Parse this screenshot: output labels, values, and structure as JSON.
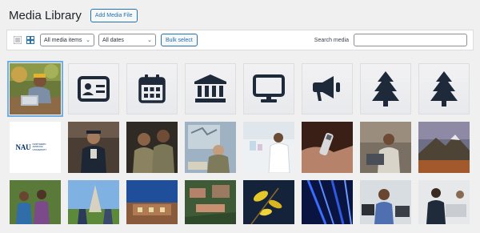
{
  "header": {
    "title": "Media Library",
    "add_button": "Add Media File"
  },
  "toolbar": {
    "list_view_icon": "list-view-icon",
    "grid_view_icon": "grid-view-icon",
    "media_type_select": "All media items",
    "date_select": "All dates",
    "bulk_select": "Bulk select",
    "search_label": "Search media",
    "search_value": ""
  },
  "grid": {
    "row1": [
      {
        "kind": "photo",
        "name": "photo-person-laptop"
      },
      {
        "kind": "icon",
        "name": "id-card-icon"
      },
      {
        "kind": "icon",
        "name": "calendar-icon"
      },
      {
        "kind": "icon",
        "name": "bank-icon"
      },
      {
        "kind": "icon",
        "name": "monitor-icon"
      },
      {
        "kind": "icon",
        "name": "megaphone-icon"
      },
      {
        "kind": "icon",
        "name": "pine-tree-icon"
      },
      {
        "kind": "icon",
        "name": "pine-tree-icon"
      }
    ],
    "logo": {
      "main": "NAU",
      "sub": "NORTHERN ARIZONA UNIVERSITY"
    }
  },
  "colors": {
    "accent": "#2271b1",
    "icon_fill": "#1e2a3a",
    "selected_outline": "#72aee6"
  }
}
